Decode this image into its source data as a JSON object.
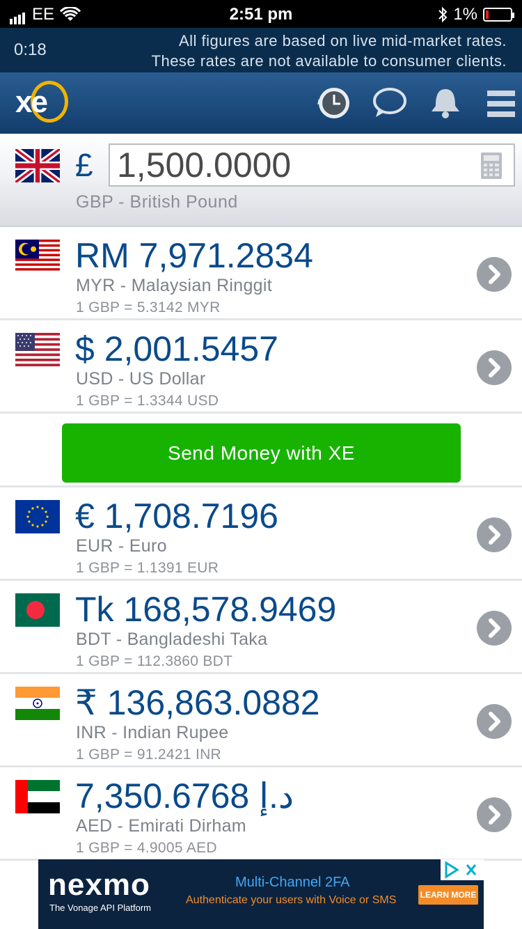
{
  "status_bar": {
    "carrier": "EE",
    "time": "2:51 pm",
    "battery": "1%"
  },
  "notice": {
    "timer": "0:18",
    "line1": "All figures are based on live mid-market rates.",
    "line2": "These rates are not available to consumer clients."
  },
  "base": {
    "symbol": "£",
    "amount": "1,500.0000",
    "name": "GBP - British Pound",
    "flag": "uk"
  },
  "rows": [
    {
      "flag": "malaysia",
      "value": "RM 7,971.2834",
      "name": "MYR - Malaysian Ringgit",
      "rate": "1 GBP = 5.3142 MYR"
    },
    {
      "flag": "usa",
      "value": "$ 2,001.5457",
      "name": "USD - US Dollar",
      "rate": "1 GBP = 1.3344 USD"
    },
    {
      "flag": "eu",
      "value": "€ 1,708.7196",
      "name": "EUR - Euro",
      "rate": "1 GBP = 1.1391 EUR"
    },
    {
      "flag": "bangladesh",
      "value": "Tk 168,578.9469",
      "name": "BDT - Bangladeshi Taka",
      "rate": "1 GBP = 112.3860 BDT"
    },
    {
      "flag": "india",
      "value": "₹ 136,863.0882",
      "name": "INR - Indian Rupee",
      "rate": "1 GBP = 91.2421 INR"
    },
    {
      "flag": "uae",
      "value": "د.إ 7,350.6768",
      "name": "AED - Emirati Dirham",
      "rate": "1 GBP = 4.9005 AED"
    }
  ],
  "send_money": {
    "label": "Send Money with XE"
  },
  "ad": {
    "brand": "nexmo",
    "tagline": "The Vonage API Platform",
    "headline": "Multi-Channel 2FA",
    "subline": "Authenticate your users with Voice or SMS",
    "cta": "LEARN MORE"
  },
  "logo": "xe",
  "colors": {
    "accent_blue": "#0a4a8a",
    "send_green": "#18b300",
    "header_blue": "#1f4f80",
    "logo_ring": "#f2b300"
  }
}
